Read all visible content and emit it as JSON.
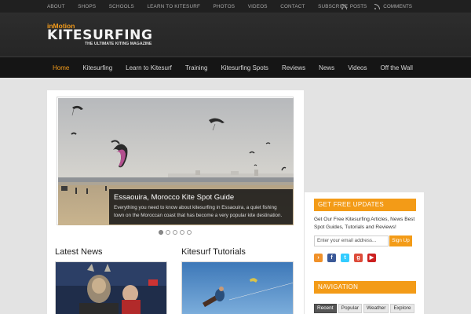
{
  "top_nav": [
    "About",
    "Shops",
    "Schools",
    "Learn to Kitesurf",
    "Photos",
    "Videos",
    "Contact",
    "Subscribe"
  ],
  "top_right": {
    "posts": "Posts",
    "comments": "Comments"
  },
  "logo": {
    "prefix": "inMotion",
    "name": "KITESURFING",
    "tagline": "The Ultimate Kiting Magazine"
  },
  "main_nav": [
    "Home",
    "Kitesurfing",
    "Learn to Kitesurf",
    "Training",
    "Kitesurfing Spots",
    "Reviews",
    "News",
    "Videos",
    "Off the Wall"
  ],
  "slider": {
    "title": "Essaouira, Morocco Kite Spot Guide",
    "text": "Everything you need to know about kitesurfing in Essaouira, a quiet fishing town on the Moroccan coast that has become a very popular kite destination.",
    "active_dot": 1,
    "dot_count": 5
  },
  "sections": {
    "latest_news": "Latest News",
    "tutorials": "Kitesurf Tutorials"
  },
  "widgets": {
    "updates": {
      "title": "Get Free Updates",
      "text": "Get Our Free Kitesurfing Articles, News Best Spot Guides, Tutorials and Reviews!",
      "email_placeholder": "Enter your email address...",
      "button": "Sign Up"
    },
    "navigation": {
      "title": "Navigation",
      "tabs": [
        "Recent",
        "Popular",
        "Weather",
        "Explore"
      ]
    }
  },
  "colors": {
    "accent": "#f39b17",
    "dark": "#1c1c1c"
  }
}
